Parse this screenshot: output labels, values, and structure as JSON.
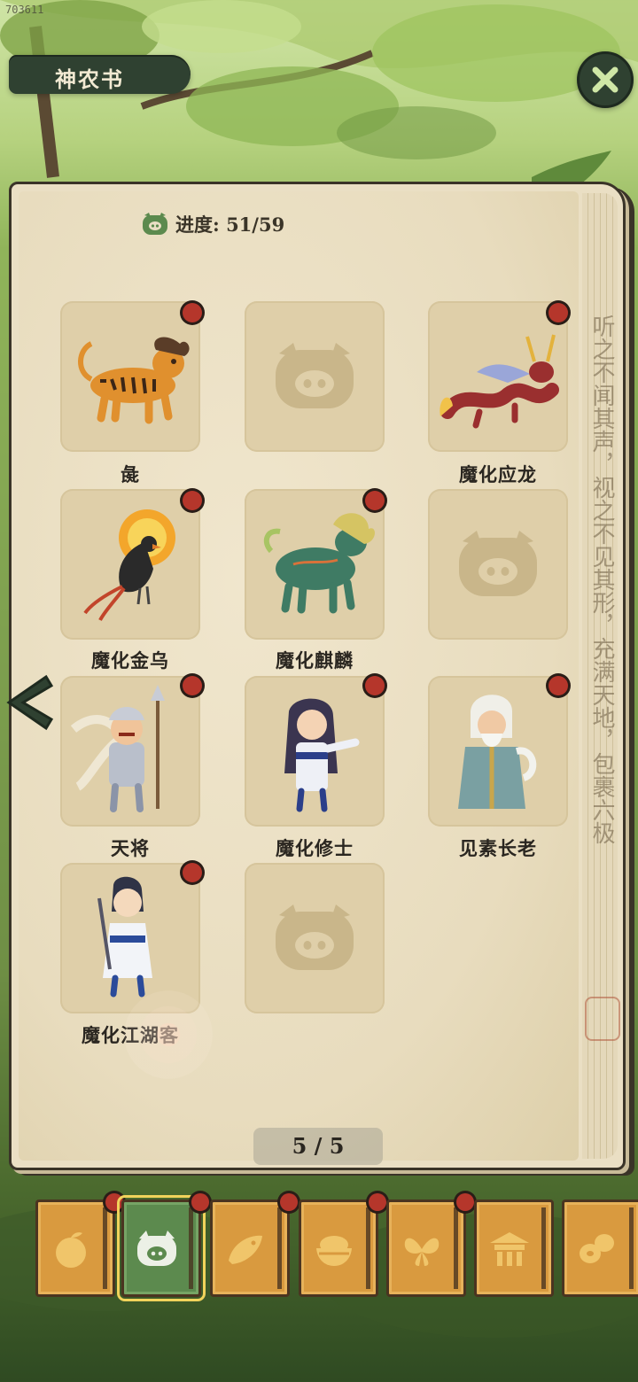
{
  "debug_id": "703611",
  "header": {
    "title": "神农书",
    "close_icon": "close-x-icon"
  },
  "progress": {
    "label": "进度: 51/59",
    "icon": "pig-face-icon"
  },
  "cards": [
    {
      "label": "彘",
      "state": "unlocked",
      "figure": "striped-tiger-beast",
      "new": true
    },
    {
      "label": "",
      "state": "locked",
      "figure": "pig-silhouette",
      "new": false
    },
    {
      "label": "魔化应龙",
      "state": "unlocked",
      "figure": "winged-red-dragon",
      "new": true
    },
    {
      "label": "魔化金乌",
      "state": "unlocked",
      "figure": "fire-crow",
      "new": true
    },
    {
      "label": "魔化麒麟",
      "state": "unlocked",
      "figure": "green-qilin",
      "new": true
    },
    {
      "label": "",
      "state": "locked",
      "figure": "pig-silhouette",
      "new": false
    },
    {
      "label": "天将",
      "state": "unlocked",
      "figure": "armored-general",
      "new": true
    },
    {
      "label": "魔化修士",
      "state": "unlocked",
      "figure": "robed-cultivator",
      "new": true
    },
    {
      "label": "见素长老",
      "state": "unlocked",
      "figure": "white-beard-elder",
      "new": true
    },
    {
      "label": "魔化江湖客",
      "state": "unlocked",
      "figure": "swordsman-wanderer",
      "new": true
    },
    {
      "label": "",
      "state": "locked",
      "figure": "pig-silhouette",
      "new": false
    }
  ],
  "side_text": "听之不闻其声，视之不见其形，充满天地，包裹六极",
  "pagination": {
    "text": "5 / 5"
  },
  "tabs": [
    {
      "icon": "fruit-icon",
      "active": false,
      "new": true
    },
    {
      "icon": "pig-face-icon",
      "active": true,
      "new": true
    },
    {
      "icon": "fish-icon",
      "active": false,
      "new": true
    },
    {
      "icon": "rice-bowl-icon",
      "active": false,
      "new": true
    },
    {
      "icon": "butterfly-icon",
      "active": false,
      "new": true
    },
    {
      "icon": "pavilion-icon",
      "active": false,
      "new": false
    },
    {
      "icon": "beans-icon",
      "active": false,
      "new": false
    }
  ],
  "colors": {
    "frame_dark": "#2f4131",
    "paper": "#eadfc4",
    "slot": "#dfcfa9",
    "new_dot": "#b5362b",
    "tab_orange": "#d99a3f",
    "tab_active": "#5c8a4e"
  }
}
